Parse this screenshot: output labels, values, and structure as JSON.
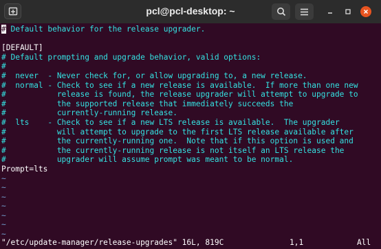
{
  "window": {
    "title": "pcl@pcl-desktop: ~"
  },
  "icons": {
    "new_tab": "new-tab-icon",
    "search": "search-icon",
    "menu": "hamburger-menu-icon",
    "minimize": "minimize-icon",
    "maximize": "maximize-icon",
    "close": "close-icon"
  },
  "colors": {
    "background": "#300a24",
    "comment": "#34e2e2",
    "text": "#ffffff",
    "tilde": "#729fcf",
    "close": "#e95420"
  },
  "editor": {
    "cursor_char": "#",
    "lines": [
      {
        "type": "comment",
        "text": " Default behavior for the release upgrader."
      },
      {
        "type": "normal",
        "text": ""
      },
      {
        "type": "normal",
        "text": "[DEFAULT]"
      },
      {
        "type": "comment",
        "text": "# Default prompting and upgrade behavior, valid options:"
      },
      {
        "type": "comment",
        "text": "#"
      },
      {
        "type": "comment",
        "text": "#  never  - Never check for, or allow upgrading to, a new release."
      },
      {
        "type": "comment",
        "text": "#  normal - Check to see if a new release is available.  If more than one new"
      },
      {
        "type": "comment",
        "text": "#           release is found, the release upgrader will attempt to upgrade to"
      },
      {
        "type": "comment",
        "text": "#           the supported release that immediately succeeds the"
      },
      {
        "type": "comment",
        "text": "#           currently-running release."
      },
      {
        "type": "comment",
        "text": "#  lts    - Check to see if a new LTS release is available.  The upgrader"
      },
      {
        "type": "comment",
        "text": "#           will attempt to upgrade to the first LTS release available after"
      },
      {
        "type": "comment",
        "text": "#           the currently-running one.  Note that if this option is used and"
      },
      {
        "type": "comment",
        "text": "#           the currently-running release is not itself an LTS release the"
      },
      {
        "type": "comment",
        "text": "#           upgrader will assume prompt was meant to be normal."
      },
      {
        "type": "normal",
        "text": "Prompt=lts"
      },
      {
        "type": "tilde",
        "text": "~"
      },
      {
        "type": "tilde",
        "text": "~"
      },
      {
        "type": "tilde",
        "text": "~"
      },
      {
        "type": "tilde",
        "text": "~"
      },
      {
        "type": "tilde",
        "text": "~"
      },
      {
        "type": "tilde",
        "text": "~"
      },
      {
        "type": "tilde",
        "text": "~"
      }
    ],
    "status": {
      "file": "\"/etc/update-manager/release-upgrades\" 16L, 819C",
      "position": "1,1",
      "scroll": "All"
    }
  }
}
